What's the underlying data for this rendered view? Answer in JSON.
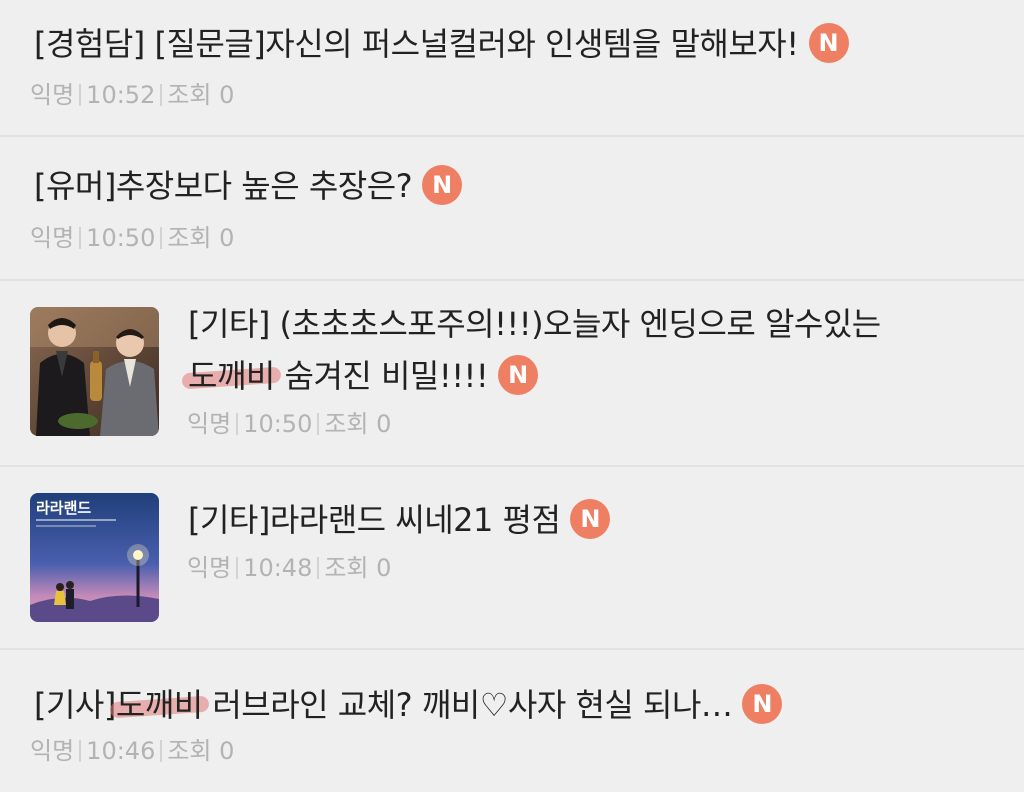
{
  "colors": {
    "background": "#efefef",
    "divider": "#e2e2e2",
    "title_text": "#222222",
    "meta_text": "#b3b3b3",
    "new_badge": "#ef7f62",
    "highlight": "#e27878"
  },
  "new_badge_label": "N",
  "posts": [
    {
      "title": "[경험담] [질문글]자신의 퍼스널컬러와 인생템을 말해보자!",
      "author": "익명",
      "time": "10:52",
      "views_label": "조회 0",
      "has_thumbnail": false,
      "is_new": true
    },
    {
      "title": "[유머]추장보다 높은 추장은?",
      "author": "익명",
      "time": "10:50",
      "views_label": "조회 0",
      "has_thumbnail": false,
      "is_new": true
    },
    {
      "title_line1": "[기타] (초초초스포주의!!!)오늘자 엔딩으로 알수있는",
      "title_line2_highlight": "도깨비",
      "title_line2_rest": " 숨겨진 비밀!!!!",
      "author": "익명",
      "time": "10:50",
      "views_label": "조회 0",
      "has_thumbnail": true,
      "thumbnail_icon": "photo-two-men-icon",
      "is_new": true
    },
    {
      "title": "[기타]라라랜드 씨네21 평점",
      "author": "익명",
      "time": "10:48",
      "views_label": "조회 0",
      "has_thumbnail": true,
      "thumbnail_icon": "movie-poster-icon",
      "thumbnail_text": "라라랜드",
      "is_new": true
    },
    {
      "title_prefix": "[기사]",
      "title_highlight": "도깨비",
      "title_rest": " 러브라인 교체? 깨비♡사자 현실 되나…",
      "author": "익명",
      "time": "10:46",
      "views_label": "조회 0",
      "has_thumbnail": false,
      "is_new": true
    }
  ]
}
